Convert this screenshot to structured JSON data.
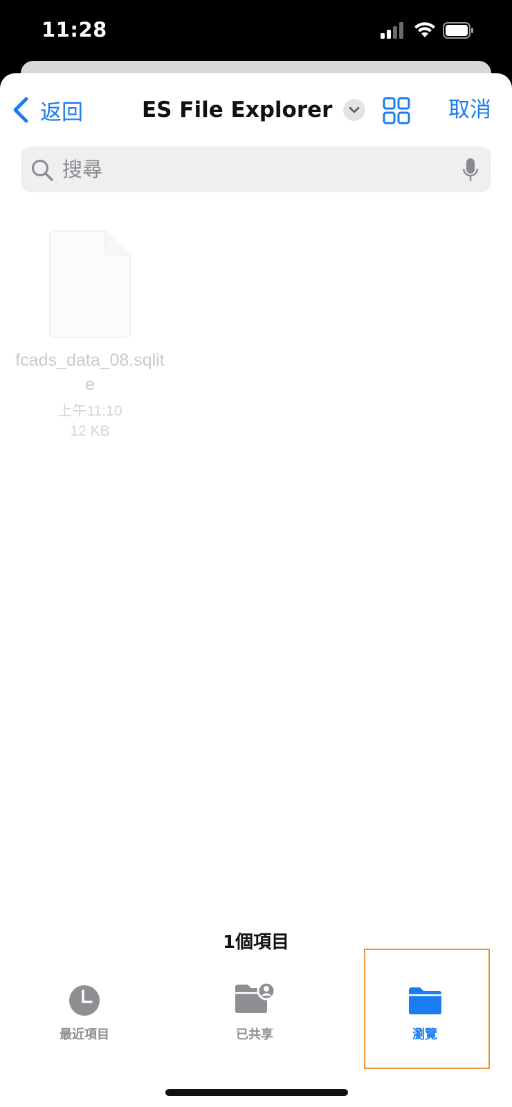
{
  "status_bar": {
    "time": "11:28",
    "icons": [
      "cellular-signal-icon",
      "wifi-icon",
      "battery-icon"
    ]
  },
  "nav": {
    "back_label": "返回",
    "title": "ES File Explorer",
    "cancel_label": "取消"
  },
  "search": {
    "placeholder": "搜尋"
  },
  "files": [
    {
      "name": "fcads_data_08.sqlite",
      "time": "上午11:10",
      "size": "12 KB"
    }
  ],
  "item_count": "1個項目",
  "tabs": [
    {
      "label": "最近項目",
      "icon": "clock-icon",
      "active": false
    },
    {
      "label": "已共享",
      "icon": "shared-folder-icon",
      "active": false
    },
    {
      "label": "瀏覽",
      "icon": "folder-icon",
      "active": true
    }
  ],
  "colors": {
    "accent": "#1a7cf0",
    "inactive": "#8e8e93",
    "highlight": "#f29035"
  }
}
